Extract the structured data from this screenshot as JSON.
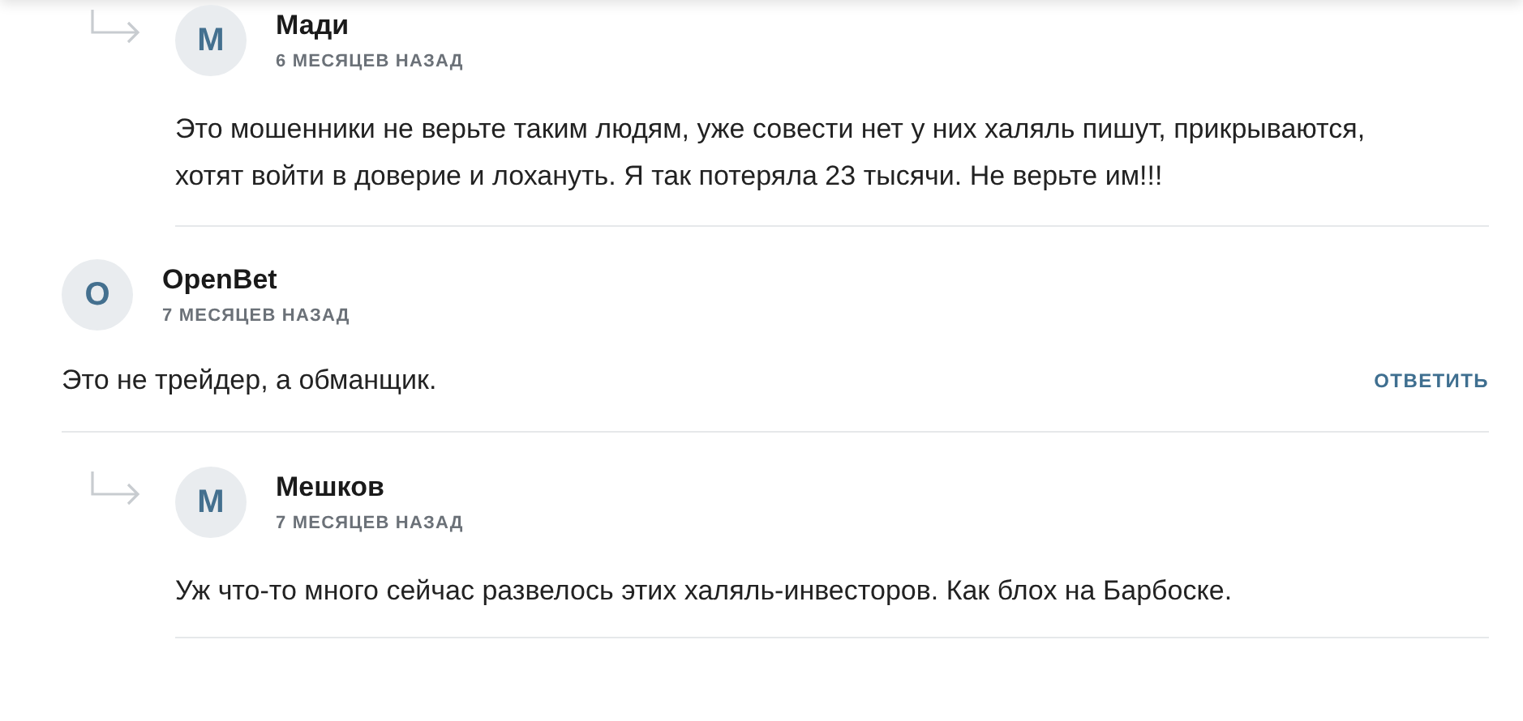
{
  "comments": [
    {
      "kind": "reply",
      "avatar": "М",
      "name": "Мади",
      "date": "6 МЕСЯЦЕВ НАЗАД",
      "text": "Это мошенники не верьте таким людям, уже совести нет у них халяль пишут, прикрываются, хотят войти в доверие и лохануть. Я так потеряла 23 тысячи. Не верьте им!!!"
    },
    {
      "kind": "top",
      "avatar": "O",
      "name": "OpenBet",
      "date": "7 МЕСЯЦЕВ НАЗАД",
      "text": "Это не трейдер, а обманщик.",
      "reply_label": "ОТВЕТИТЬ"
    },
    {
      "kind": "reply",
      "avatar": "М",
      "name": "Мешков",
      "date": "7 МЕСЯЦЕВ НАЗАД",
      "text": "Уж что-то много сейчас развелось этих халяль-инвесторов. Как блох на Барбоске."
    }
  ]
}
